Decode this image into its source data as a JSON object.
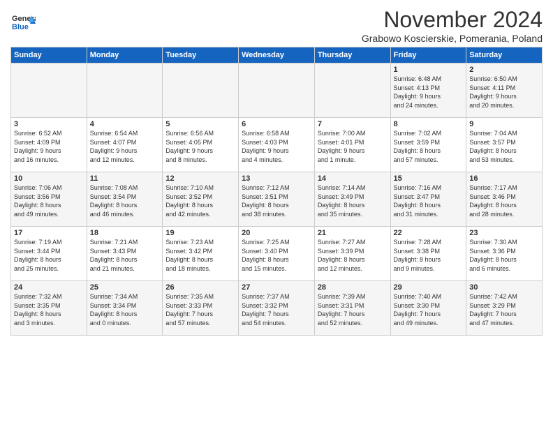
{
  "logo": {
    "general": "General",
    "blue": "Blue"
  },
  "title": "November 2024",
  "subtitle": "Grabowo Koscierskie, Pomerania, Poland",
  "days_header": [
    "Sunday",
    "Monday",
    "Tuesday",
    "Wednesday",
    "Thursday",
    "Friday",
    "Saturday"
  ],
  "weeks": [
    [
      {
        "day": "",
        "info": ""
      },
      {
        "day": "",
        "info": ""
      },
      {
        "day": "",
        "info": ""
      },
      {
        "day": "",
        "info": ""
      },
      {
        "day": "",
        "info": ""
      },
      {
        "day": "1",
        "info": "Sunrise: 6:48 AM\nSunset: 4:13 PM\nDaylight: 9 hours\nand 24 minutes."
      },
      {
        "day": "2",
        "info": "Sunrise: 6:50 AM\nSunset: 4:11 PM\nDaylight: 9 hours\nand 20 minutes."
      }
    ],
    [
      {
        "day": "3",
        "info": "Sunrise: 6:52 AM\nSunset: 4:09 PM\nDaylight: 9 hours\nand 16 minutes."
      },
      {
        "day": "4",
        "info": "Sunrise: 6:54 AM\nSunset: 4:07 PM\nDaylight: 9 hours\nand 12 minutes."
      },
      {
        "day": "5",
        "info": "Sunrise: 6:56 AM\nSunset: 4:05 PM\nDaylight: 9 hours\nand 8 minutes."
      },
      {
        "day": "6",
        "info": "Sunrise: 6:58 AM\nSunset: 4:03 PM\nDaylight: 9 hours\nand 4 minutes."
      },
      {
        "day": "7",
        "info": "Sunrise: 7:00 AM\nSunset: 4:01 PM\nDaylight: 9 hours\nand 1 minute."
      },
      {
        "day": "8",
        "info": "Sunrise: 7:02 AM\nSunset: 3:59 PM\nDaylight: 8 hours\nand 57 minutes."
      },
      {
        "day": "9",
        "info": "Sunrise: 7:04 AM\nSunset: 3:57 PM\nDaylight: 8 hours\nand 53 minutes."
      }
    ],
    [
      {
        "day": "10",
        "info": "Sunrise: 7:06 AM\nSunset: 3:56 PM\nDaylight: 8 hours\nand 49 minutes."
      },
      {
        "day": "11",
        "info": "Sunrise: 7:08 AM\nSunset: 3:54 PM\nDaylight: 8 hours\nand 46 minutes."
      },
      {
        "day": "12",
        "info": "Sunrise: 7:10 AM\nSunset: 3:52 PM\nDaylight: 8 hours\nand 42 minutes."
      },
      {
        "day": "13",
        "info": "Sunrise: 7:12 AM\nSunset: 3:51 PM\nDaylight: 8 hours\nand 38 minutes."
      },
      {
        "day": "14",
        "info": "Sunrise: 7:14 AM\nSunset: 3:49 PM\nDaylight: 8 hours\nand 35 minutes."
      },
      {
        "day": "15",
        "info": "Sunrise: 7:16 AM\nSunset: 3:47 PM\nDaylight: 8 hours\nand 31 minutes."
      },
      {
        "day": "16",
        "info": "Sunrise: 7:17 AM\nSunset: 3:46 PM\nDaylight: 8 hours\nand 28 minutes."
      }
    ],
    [
      {
        "day": "17",
        "info": "Sunrise: 7:19 AM\nSunset: 3:44 PM\nDaylight: 8 hours\nand 25 minutes."
      },
      {
        "day": "18",
        "info": "Sunrise: 7:21 AM\nSunset: 3:43 PM\nDaylight: 8 hours\nand 21 minutes."
      },
      {
        "day": "19",
        "info": "Sunrise: 7:23 AM\nSunset: 3:42 PM\nDaylight: 8 hours\nand 18 minutes."
      },
      {
        "day": "20",
        "info": "Sunrise: 7:25 AM\nSunset: 3:40 PM\nDaylight: 8 hours\nand 15 minutes."
      },
      {
        "day": "21",
        "info": "Sunrise: 7:27 AM\nSunset: 3:39 PM\nDaylight: 8 hours\nand 12 minutes."
      },
      {
        "day": "22",
        "info": "Sunrise: 7:28 AM\nSunset: 3:38 PM\nDaylight: 8 hours\nand 9 minutes."
      },
      {
        "day": "23",
        "info": "Sunrise: 7:30 AM\nSunset: 3:36 PM\nDaylight: 8 hours\nand 6 minutes."
      }
    ],
    [
      {
        "day": "24",
        "info": "Sunrise: 7:32 AM\nSunset: 3:35 PM\nDaylight: 8 hours\nand 3 minutes."
      },
      {
        "day": "25",
        "info": "Sunrise: 7:34 AM\nSunset: 3:34 PM\nDaylight: 8 hours\nand 0 minutes."
      },
      {
        "day": "26",
        "info": "Sunrise: 7:35 AM\nSunset: 3:33 PM\nDaylight: 7 hours\nand 57 minutes."
      },
      {
        "day": "27",
        "info": "Sunrise: 7:37 AM\nSunset: 3:32 PM\nDaylight: 7 hours\nand 54 minutes."
      },
      {
        "day": "28",
        "info": "Sunrise: 7:39 AM\nSunset: 3:31 PM\nDaylight: 7 hours\nand 52 minutes."
      },
      {
        "day": "29",
        "info": "Sunrise: 7:40 AM\nSunset: 3:30 PM\nDaylight: 7 hours\nand 49 minutes."
      },
      {
        "day": "30",
        "info": "Sunrise: 7:42 AM\nSunset: 3:29 PM\nDaylight: 7 hours\nand 47 minutes."
      }
    ]
  ]
}
